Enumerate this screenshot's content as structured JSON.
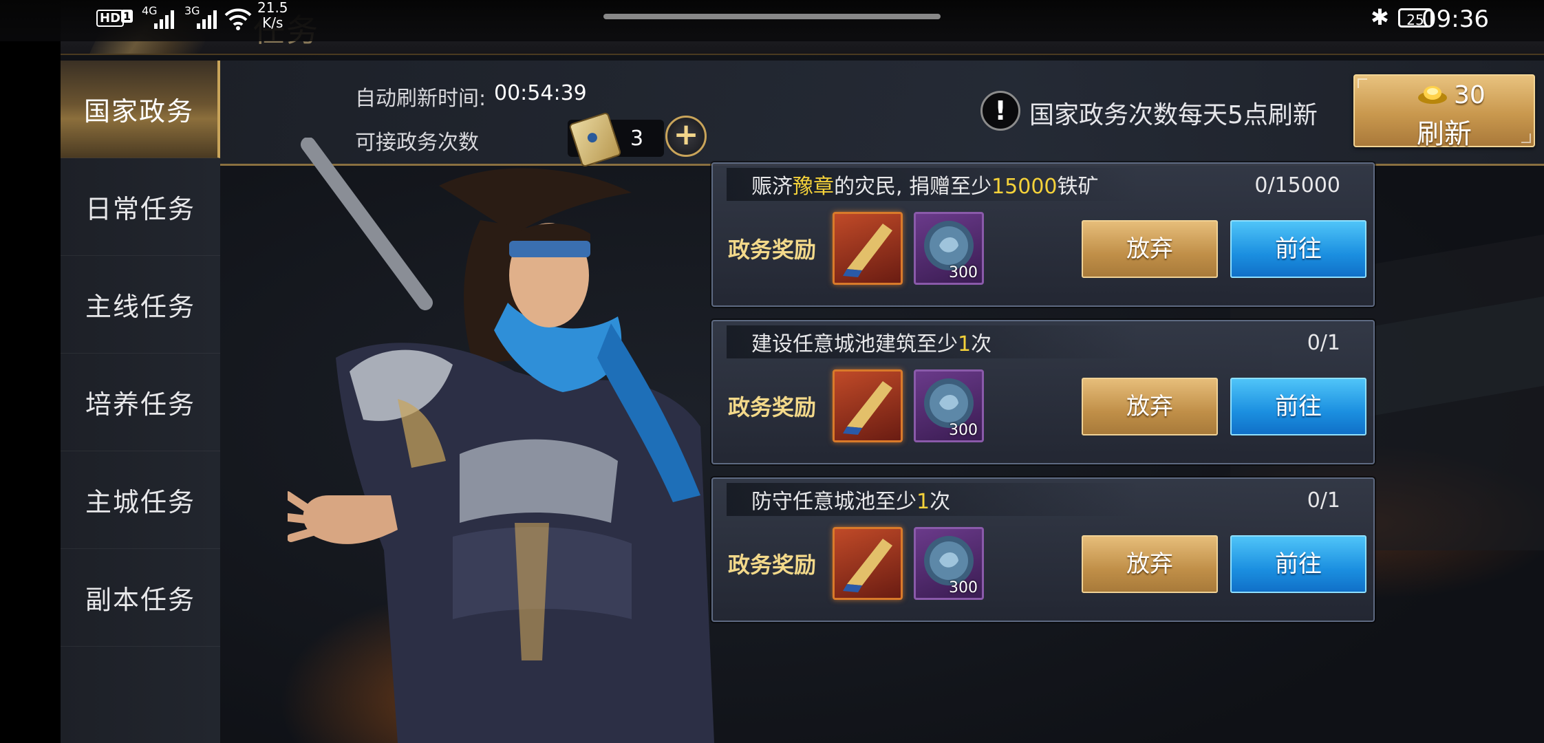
{
  "status_bar": {
    "hd": "HD",
    "sim": "1",
    "net1": "4G",
    "net2": "3G",
    "speed_value": "21.5",
    "speed_unit": "K/s",
    "battery": "25",
    "time": "09:36"
  },
  "header": {
    "title": "任务"
  },
  "sidebar": {
    "items": [
      {
        "label": "国家政务",
        "active": true
      },
      {
        "label": "日常任务"
      },
      {
        "label": "主线任务"
      },
      {
        "label": "培养任务"
      },
      {
        "label": "主城任务"
      },
      {
        "label": "副本任务"
      }
    ]
  },
  "info": {
    "refresh_label": "自动刷新时间:",
    "refresh_time": "00:54:39",
    "count_label": "可接政务次数",
    "count_value": "3",
    "add_symbol": "+",
    "notice_symbol": "!",
    "notice": "国家政务次数每天5点刷新",
    "refresh_cost": "30",
    "refresh_button": "刷新"
  },
  "tasks": [
    {
      "desc_parts": [
        "赈济",
        "豫章",
        "的灾民, 捐赠至少",
        "15000",
        "铁矿"
      ],
      "progress": "0/15000",
      "reward_label": "政务奖励",
      "coin_count": "300",
      "abandon": "放弃",
      "go": "前往"
    },
    {
      "desc_parts": [
        "建设任意城池建筑至少",
        "1",
        "次"
      ],
      "progress": "0/1",
      "reward_label": "政务奖励",
      "coin_count": "300",
      "abandon": "放弃",
      "go": "前往"
    },
    {
      "desc_parts": [
        "防守任意城池至少",
        "1",
        "次"
      ],
      "progress": "0/1",
      "reward_label": "政务奖励",
      "coin_count": "300",
      "abandon": "放弃",
      "go": "前往"
    }
  ],
  "colors": {
    "highlight": "#f5d23a",
    "gold_button": "#c9984e",
    "blue_button": "#1b8fe0",
    "reward_label": "#f3d98a"
  },
  "icons": [
    "bluetooth-icon",
    "battery-icon",
    "wifi-icon",
    "signal-icon",
    "scroll-icon",
    "plus-icon",
    "exclamation-icon",
    "gold-ingot-icon",
    "horn-reward-icon",
    "coin-reward-icon"
  ]
}
